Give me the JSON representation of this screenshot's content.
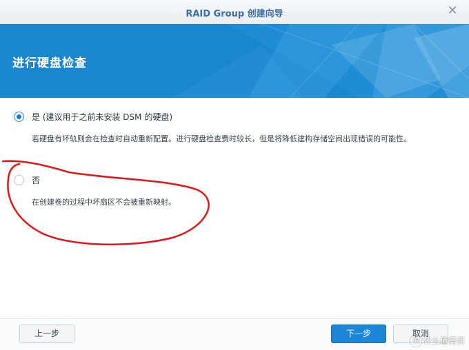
{
  "window": {
    "title": "RAID Group 创建向导",
    "close_icon": "close-icon"
  },
  "banner": {
    "title": "进行硬盘检查",
    "color": "#1a86cf"
  },
  "options": [
    {
      "label": "是 (建议用于之前未安装 DSM 的硬盘)",
      "description": "若硬盘有坏轨则会在检查时自动重新配置。进行硬盘检查费时较长，但是将降低建构存储空间出现错误的可能性。",
      "selected": true
    },
    {
      "label": "否",
      "description": "在创建卷的过程中坏扇区不会被重新映射。",
      "selected": false
    }
  ],
  "annotation": {
    "color": "#e0161b",
    "shape": "hand-drawn ellipse around option 否"
  },
  "footer": {
    "prev_label": "上一步",
    "next_label": "下一步",
    "cancel_label": "取消"
  },
  "watermark": {
    "text": "什么值得买",
    "icon_glyph": "值"
  }
}
